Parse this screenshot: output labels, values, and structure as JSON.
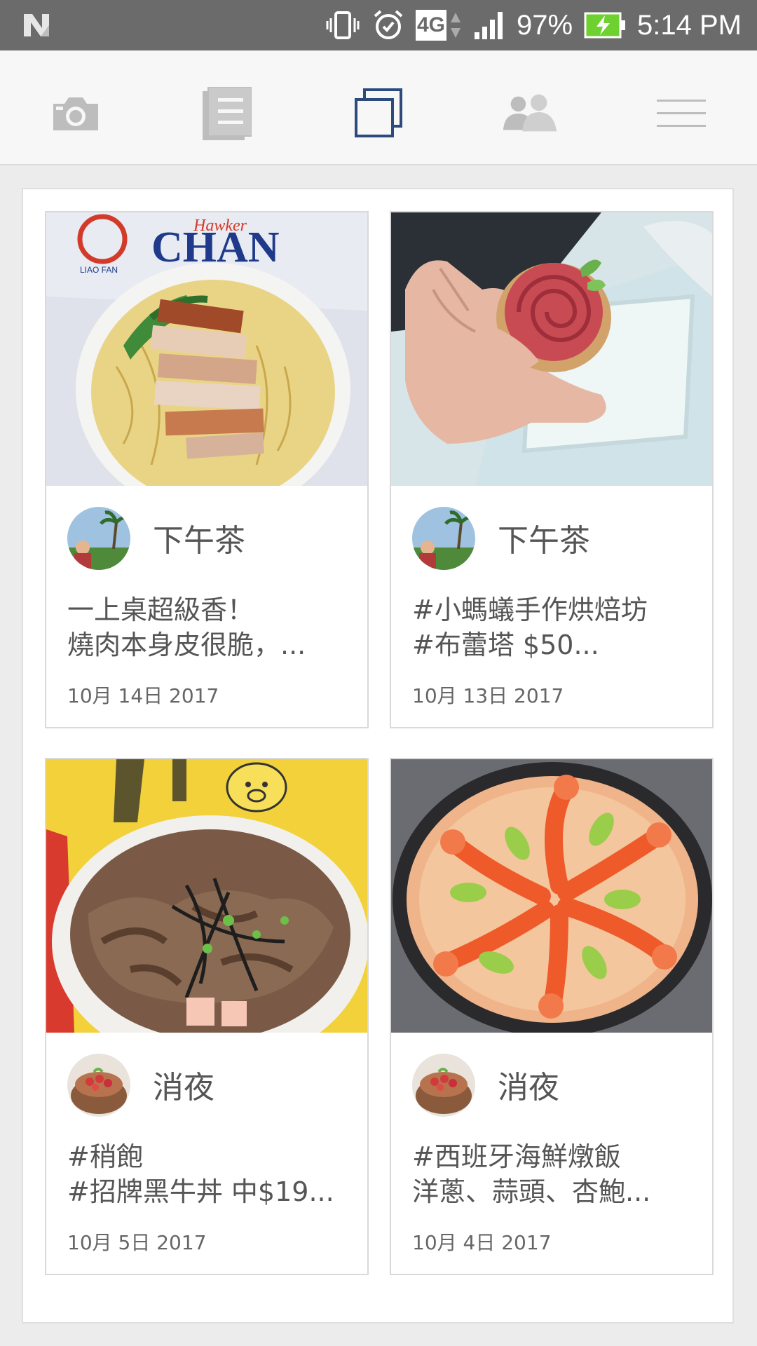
{
  "status_bar": {
    "battery": "97%",
    "time": "5:14 PM",
    "network": "4G",
    "icons": [
      "n-logo-icon",
      "vibrate-icon",
      "alarm-icon",
      "network-4g-icon",
      "signal-icon",
      "battery-charging-icon"
    ]
  },
  "nav": {
    "items": [
      {
        "name": "camera-icon",
        "active": false
      },
      {
        "name": "posts-icon",
        "active": false
      },
      {
        "name": "albums-icon",
        "active": true
      },
      {
        "name": "friends-icon",
        "active": false
      },
      {
        "name": "menu-icon",
        "active": false
      }
    ],
    "active_color": "#2d4a7c",
    "inactive_color": "#bdbdbd"
  },
  "cards": [
    {
      "album": "下午茶",
      "caption_line1": "一上桌超級香！",
      "caption_line2": "燒肉本身皮很脆，...",
      "date": "10月 14日 2017",
      "photo": "noodles-roast-pork",
      "avatar": "palm-tree-avatar"
    },
    {
      "album": "下午茶",
      "caption_line1": "#小螞蟻手作烘焙坊",
      "caption_line2": "#布蕾塔 $50...",
      "date": "10月 13日 2017",
      "photo": "rose-tart",
      "avatar": "palm-tree-avatar"
    },
    {
      "album": "消夜",
      "caption_line1": "#稍飽",
      "caption_line2": "#招牌黑牛丼 中$19...",
      "date": "10月 5日 2017",
      "photo": "beef-rice-bowl",
      "avatar": "cake-avatar"
    },
    {
      "album": "消夜",
      "caption_line1": "#西班牙海鮮燉飯",
      "caption_line2": "洋蔥、蒜頭、杏鮑...",
      "date": "10月 4日 2017",
      "photo": "seafood-paella",
      "avatar": "cake-avatar"
    }
  ],
  "photo_text": {
    "sign_word": "CHAN",
    "sign_top": "Hawker",
    "sign_small": "LIAO FAN"
  }
}
